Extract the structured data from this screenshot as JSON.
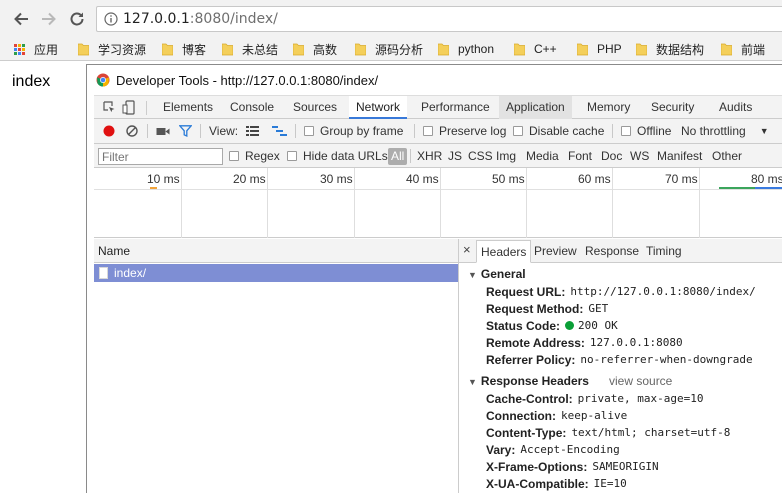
{
  "browser": {
    "address": {
      "host": "127.0.0.1",
      "rest": ":8080/index/"
    },
    "bookmarks": [
      {
        "label": "应用",
        "icon": "apps-grid-icon"
      },
      {
        "label": "学习资源",
        "icon": "folder-icon"
      },
      {
        "label": "博客",
        "icon": "folder-icon"
      },
      {
        "label": "未总结",
        "icon": "folder-icon"
      },
      {
        "label": "高数",
        "icon": "folder-icon"
      },
      {
        "label": "源码分析",
        "icon": "folder-icon"
      },
      {
        "label": "python",
        "icon": "folder-icon"
      },
      {
        "label": "C++",
        "icon": "folder-icon"
      },
      {
        "label": "PHP",
        "icon": "folder-icon"
      },
      {
        "label": "数据结构",
        "icon": "folder-icon"
      },
      {
        "label": "前端",
        "icon": "folder-icon"
      }
    ]
  },
  "page": {
    "heading": "index"
  },
  "devtools": {
    "title": "Developer Tools - http://127.0.0.1:8080/index/",
    "tabs": [
      {
        "label": "Elements"
      },
      {
        "label": "Console"
      },
      {
        "label": "Sources"
      },
      {
        "label": "Network"
      },
      {
        "label": "Performance"
      },
      {
        "label": "Application"
      },
      {
        "label": "Memory"
      },
      {
        "label": "Security"
      },
      {
        "label": "Audits"
      }
    ],
    "toolbar": {
      "view_label": "View:",
      "group_by_frame": "Group by frame",
      "preserve_log": "Preserve log",
      "disable_cache": "Disable cache",
      "offline": "Offline",
      "throttling": "No throttling"
    },
    "filter": {
      "placeholder": "Filter",
      "regex": "Regex",
      "hide_data_urls": "Hide data URLs",
      "types": [
        "All",
        "XHR",
        "JS",
        "CSS",
        "Img",
        "Media",
        "Font",
        "Doc",
        "WS",
        "Manifest",
        "Other"
      ]
    },
    "timeline": {
      "ticks": [
        "10 ms",
        "20 ms",
        "30 ms",
        "40 ms",
        "50 ms",
        "60 ms",
        "70 ms",
        "80 ms"
      ]
    },
    "requests": {
      "column": "Name",
      "rows": [
        {
          "name": "index/"
        }
      ]
    },
    "details": {
      "close": "×",
      "tabs": [
        "Headers",
        "Preview",
        "Response",
        "Timing"
      ],
      "general": {
        "title": "General",
        "rows": [
          {
            "key": "Request URL:",
            "value": "http://127.0.0.1:8080/index/"
          },
          {
            "key": "Request Method:",
            "value": "GET"
          },
          {
            "key": "Status Code:",
            "value": "200 OK"
          },
          {
            "key": "Remote Address:",
            "value": "127.0.0.1:8080"
          },
          {
            "key": "Referrer Policy:",
            "value": "no-referrer-when-downgrade"
          }
        ]
      },
      "response_headers": {
        "title": "Response Headers",
        "view_source": "view source",
        "rows": [
          {
            "key": "Cache-Control:",
            "value": "private, max-age=10"
          },
          {
            "key": "Connection:",
            "value": "keep-alive"
          },
          {
            "key": "Content-Type:",
            "value": "text/html; charset=utf-8"
          },
          {
            "key": "Vary:",
            "value": "Accept-Encoding"
          },
          {
            "key": "X-Frame-Options:",
            "value": "SAMEORIGIN"
          },
          {
            "key": "X-UA-Compatible:",
            "value": "IE=10"
          }
        ]
      }
    }
  },
  "colors": {
    "selection": "#7e8ed4",
    "active_tab_underline": "#3879d9",
    "record": "#e01010",
    "status_ok": "#0a9f37",
    "folder": "#f4cf5a"
  }
}
